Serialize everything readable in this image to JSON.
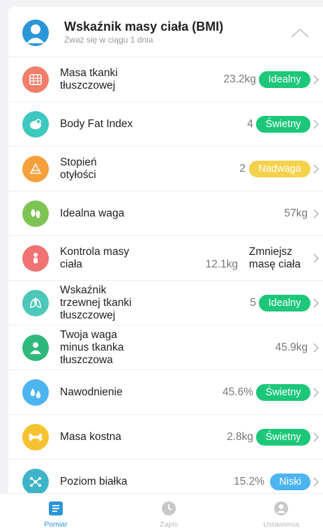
{
  "header": {
    "title": "Wskaźnik masy ciała (BMI)",
    "subtitle": "Zważ się w ciągu 1 dnia"
  },
  "colors": {
    "green": "#1dc77a",
    "yellow": "#f5d24c",
    "blue": "#4cb4f0",
    "accent": "#2a96d8"
  },
  "rows": [
    {
      "label": "Masa tkanki\ntłuszczowej",
      "value": "23.2kg",
      "badge": "Idealny",
      "icon": "fat-mass-icon"
    },
    {
      "label": "Body Fat Index",
      "value": "4",
      "badge": "Świetny",
      "icon": "body-fat-index-icon"
    },
    {
      "label": "Stopień\notyłości",
      "value": "2",
      "badge": "Nadwaga",
      "icon": "obesity-degree-icon"
    },
    {
      "label": "Idealna waga",
      "value": "57kg",
      "badge": "",
      "icon": "footprints-icon"
    },
    {
      "label": "Kontrola masy\nciała",
      "value": "12.1kg",
      "badge": "Zmniejsz\nmasę ciała",
      "icon": "weight-control-icon"
    },
    {
      "label": "Wskaźnik\ntrzewnej tkanki\ntłuszczowej",
      "value": "5",
      "badge": "Idealny",
      "icon": "lungs-icon"
    },
    {
      "label": "Twoja waga\nminus tkanka\ntłuszczowa",
      "value": "45.9kg",
      "badge": "",
      "icon": "lean-mass-icon"
    },
    {
      "label": "Nawodnienie",
      "value": "45.6%",
      "badge": "Świetny",
      "icon": "water-drops-icon"
    },
    {
      "label": "Masa kostna",
      "value": "2.8kg",
      "badge": "Świetny",
      "icon": "bone-icon"
    },
    {
      "label": "Poziom białka",
      "value": "15.2%",
      "badge": "Niski",
      "icon": "protein-molecule-icon"
    }
  ],
  "tabs": [
    {
      "label": "Pomiar",
      "icon": "measurement-icon",
      "active": true
    },
    {
      "label": "Zapis",
      "icon": "clock-icon",
      "active": false
    },
    {
      "label": "Ustawienia",
      "icon": "user-settings-icon",
      "active": false
    }
  ]
}
